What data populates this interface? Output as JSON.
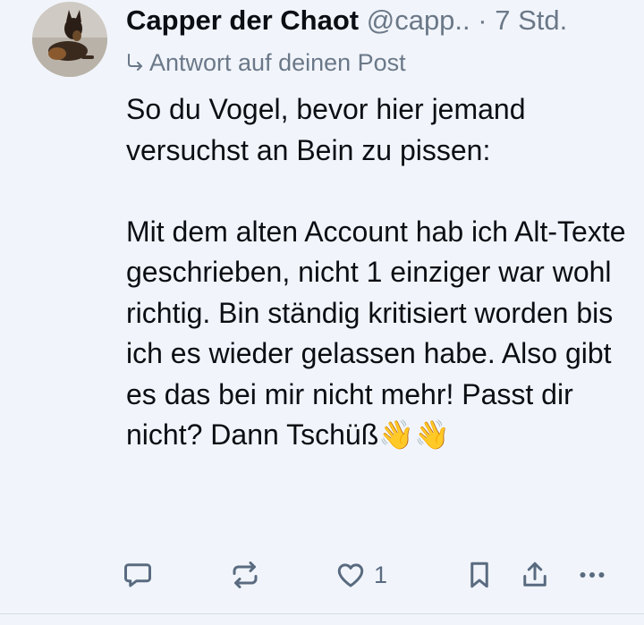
{
  "post": {
    "author_name": "Capper der Chaot",
    "handle": "@capp..",
    "separator": "·",
    "time": "7 Std.",
    "reply_label": "Antwort auf deinen Post",
    "text": "So du Vogel, bevor hier jemand versuchst an Bein zu pissen:\n\nMit dem alten Account hab ich Alt-Texte geschrieben, nicht 1 einziger war wohl richtig. Bin ständig kritisiert worden bis ich es wieder gelassen habe. Also gibt es das bei mir nicht mehr! Passt dir nicht? Dann Tschüß👋👋"
  },
  "actions": {
    "like_count": "1",
    "icons": [
      "reply-icon",
      "repost-icon",
      "like-icon",
      "bookmark-icon",
      "share-icon",
      "more-icon"
    ]
  },
  "colors": {
    "background": "#f1f5fb",
    "text": "#0b0f14",
    "muted": "#6b7888",
    "icon": "#5a6b80"
  }
}
